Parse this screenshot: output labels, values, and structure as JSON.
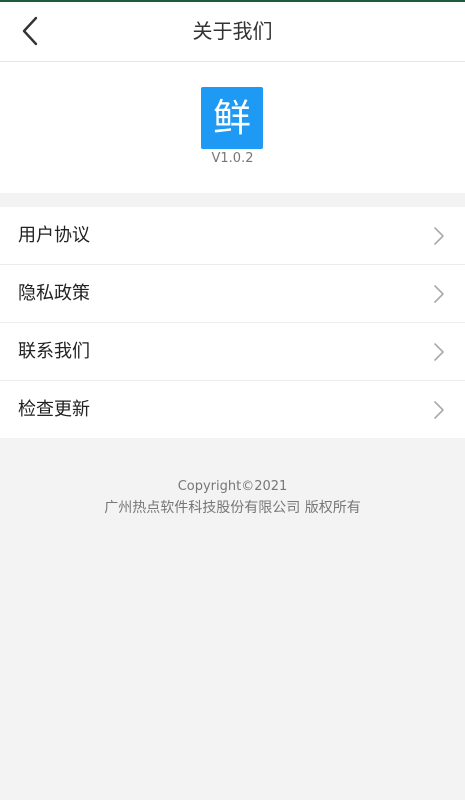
{
  "header": {
    "title": "关于我们",
    "back_icon": "chevron-left-icon"
  },
  "about": {
    "logo_char": "鲜",
    "logo_color": "#1e9af5",
    "version": "V1.0.2"
  },
  "menu": {
    "items": [
      {
        "label": "用户协议"
      },
      {
        "label": "隐私政策"
      },
      {
        "label": "联系我们"
      },
      {
        "label": "检查更新"
      }
    ],
    "chevron_icon": "chevron-right-icon"
  },
  "footer": {
    "copyright": "Copyright©2021",
    "company": "广州热点软件科技股份有限公司 版权所有"
  },
  "colors": {
    "top_strip": "#1f5a3d",
    "background": "#f3f3f3",
    "surface": "#ffffff"
  }
}
